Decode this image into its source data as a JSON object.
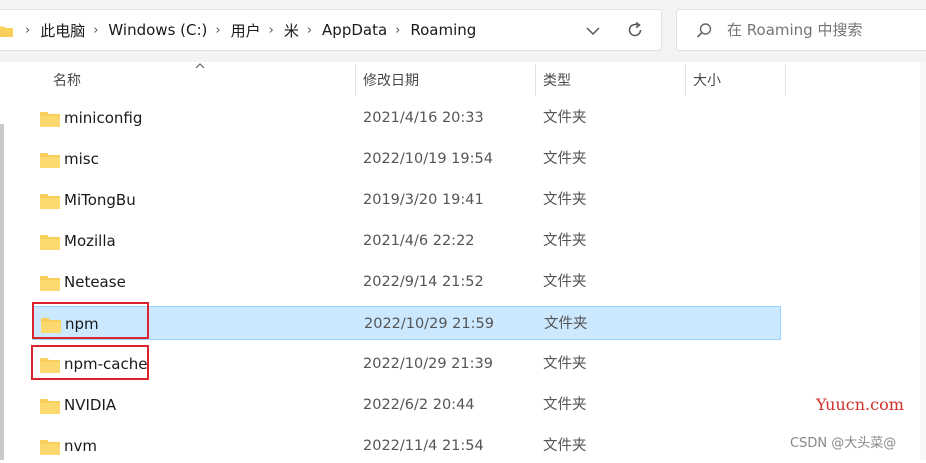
{
  "address": {
    "crumbs": [
      "此电脑",
      "Windows (C:)",
      "用户",
      "米",
      "AppData",
      "Roaming"
    ]
  },
  "search": {
    "placeholder": "在 Roaming 中搜索"
  },
  "columns": {
    "name": "名称",
    "date": "修改日期",
    "type": "类型",
    "size": "大小"
  },
  "rows": [
    {
      "name": "miniconfig",
      "date": "2021/4/16 20:33",
      "type": "文件夹"
    },
    {
      "name": "misc",
      "date": "2022/10/19 19:54",
      "type": "文件夹"
    },
    {
      "name": "MiTongBu",
      "date": "2019/3/20 19:41",
      "type": "文件夹"
    },
    {
      "name": "Mozilla",
      "date": "2021/4/6 22:22",
      "type": "文件夹"
    },
    {
      "name": "Netease",
      "date": "2022/9/14 21:52",
      "type": "文件夹"
    },
    {
      "name": "npm",
      "date": "2022/10/29 21:59",
      "type": "文件夹"
    },
    {
      "name": "npm-cache",
      "date": "2022/10/29 21:39",
      "type": "文件夹"
    },
    {
      "name": "NVIDIA",
      "date": "2022/6/2 20:44",
      "type": "文件夹"
    },
    {
      "name": "nvm",
      "date": "2022/11/4 21:54",
      "type": "文件夹"
    }
  ],
  "selected_row": "npm",
  "colors": {
    "selection": "#cce8ff",
    "highlight": "#d9232e",
    "folder": "#f8cf5b"
  },
  "watermarks": {
    "site": "Yuucn.com",
    "csdn": "CSDN @大头菜@"
  }
}
